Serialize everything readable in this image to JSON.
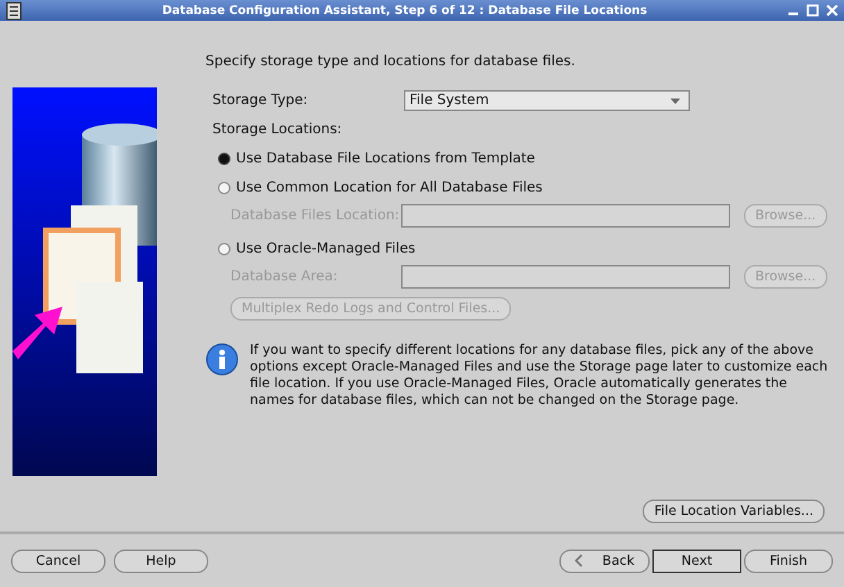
{
  "window": {
    "title": "Database Configuration Assistant, Step 6 of 12 : Database File Locations"
  },
  "intro": "Specify storage type and locations for database files.",
  "storage_type": {
    "label": "Storage Type:",
    "value": "File System"
  },
  "storage_locations_label": "Storage Locations:",
  "options": [
    {
      "kind": "radio",
      "label": "Use Database File Locations from Template",
      "selected": true
    },
    {
      "kind": "radio",
      "label": "Use Common Location for All Database Files",
      "selected": false
    },
    {
      "kind": "field",
      "label": "Database Files Location:",
      "button": "Browse...",
      "disabled": true
    },
    {
      "kind": "radio",
      "label": "Use Oracle-Managed Files",
      "selected": false
    },
    {
      "kind": "field",
      "label": "Database Area:",
      "button": "Browse...",
      "disabled": true
    },
    {
      "kind": "button",
      "label": "Multiplex Redo Logs and Control Files...",
      "disabled": true
    }
  ],
  "info": "If you want to specify different locations for any database files, pick any of the above options except Oracle-Managed Files and use the Storage page later to customize each file location. If you use Oracle-Managed Files, Oracle automatically generates the names for database files, which can not be changed on the Storage page.",
  "file_location_button": "File Location Variables...",
  "footer": {
    "left": [
      "Cancel",
      "Help"
    ],
    "back": "Back",
    "next": "Next",
    "finish": "Finish"
  }
}
